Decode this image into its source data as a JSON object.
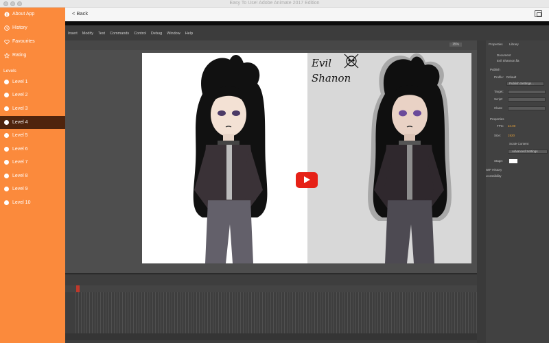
{
  "window": {
    "title": "Easy To Use! Adobe Animate 2017 Edition"
  },
  "toolbar": {
    "back_label": "< Back"
  },
  "sidebar": {
    "top_items": [
      {
        "label": "About App",
        "icon": "info-icon"
      },
      {
        "label": "History",
        "icon": "clock-icon"
      },
      {
        "label": "Favourites",
        "icon": "heart-icon"
      },
      {
        "label": "Rating",
        "icon": "star-icon"
      }
    ],
    "section_label": "Levels",
    "levels": [
      {
        "label": "Level 1"
      },
      {
        "label": "Level 2"
      },
      {
        "label": "Level 3"
      },
      {
        "label": "Level 4"
      },
      {
        "label": "Level 5"
      },
      {
        "label": "Level 6"
      },
      {
        "label": "Level 7"
      },
      {
        "label": "Level 8"
      },
      {
        "label": "Level 9"
      },
      {
        "label": "Level 10"
      }
    ],
    "active_level": "Level 4"
  },
  "video": {
    "menu": [
      "Insert",
      "Modify",
      "Text",
      "Commands",
      "Control",
      "Debug",
      "Window",
      "Help"
    ],
    "handwriting": [
      "Evil",
      "Shanon"
    ],
    "zoom": "15%",
    "panel": {
      "tabs": [
        "Properties",
        "Library"
      ],
      "doc_label": "Document",
      "doc_name": "Evil Shannon.fla",
      "publish_label": "Publish",
      "profile_label": "Profile:",
      "profile_value": "Default",
      "publish_settings": "Publish Settings...",
      "target_label": "Target:",
      "script_label": "Script:",
      "class_label": "Class:",
      "properties_label": "Properties",
      "fps_label": "FPS:",
      "fps_value": "24.00",
      "size_label": "Size:",
      "size_value": "1920",
      "scale_label": "Scale Content",
      "advanced_label": "Advanced Settings",
      "stage_label": "Stage:",
      "swf_label": "SWF History",
      "accessibility_label": "Accessibility"
    }
  },
  "colors": {
    "sidebar": "#fb8a3c",
    "active": "#4f240d",
    "play": "#e62117"
  }
}
